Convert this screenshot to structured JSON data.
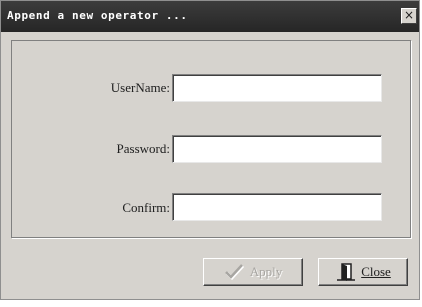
{
  "window": {
    "title": "Append a new operator ...",
    "close_glyph": "×"
  },
  "form": {
    "username_label": "UserName:",
    "username_value": "",
    "password_label": "Password:",
    "password_value": "",
    "confirm_label": "Confirm:",
    "confirm_value": ""
  },
  "buttons": {
    "apply_label": "Apply",
    "apply_enabled": false,
    "apply_icon": "checkmark-icon",
    "close_label": "Close",
    "close_icon": "door-icon"
  }
}
